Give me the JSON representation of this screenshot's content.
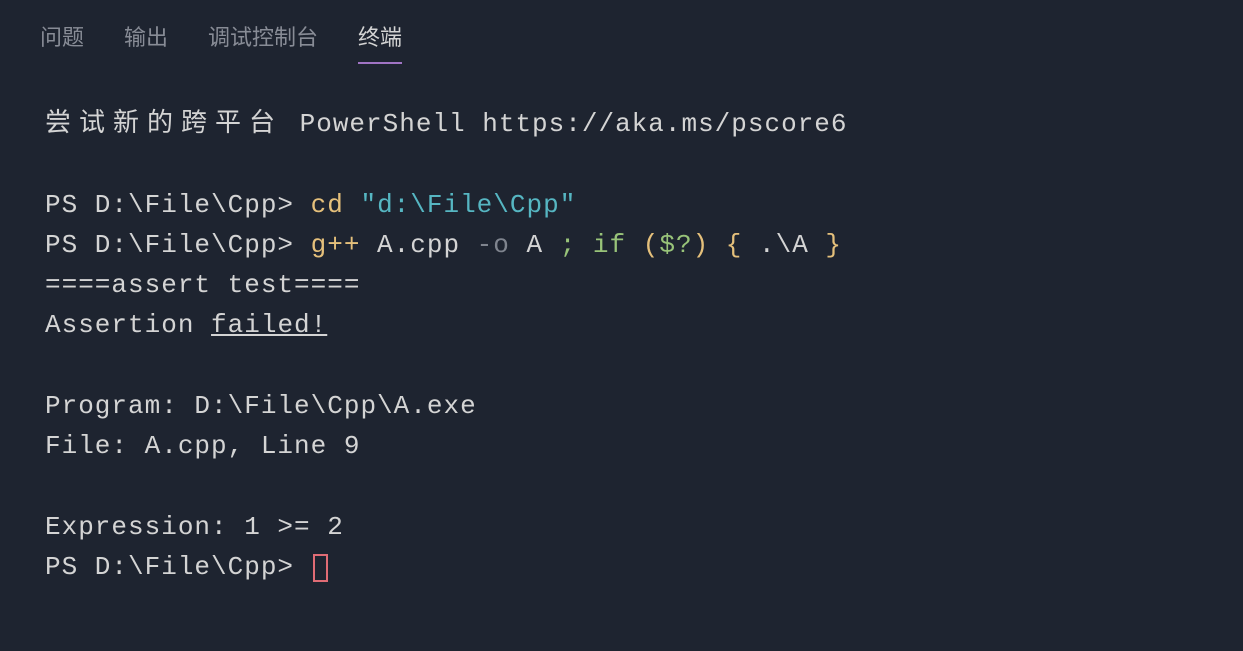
{
  "tabs": {
    "problems": "问题",
    "output": "输出",
    "debug_console": "调试控制台",
    "terminal": "终端"
  },
  "banner": {
    "cn": "尝试新的跨平台",
    "en": " PowerShell https://aka.ms/pscore6"
  },
  "prompt": "PS D:\\File\\Cpp> ",
  "cmd1": {
    "cd": "cd",
    "path": " \"d:\\File\\Cpp\""
  },
  "cmd2": {
    "gpp": "g++",
    "args1": " A.cpp ",
    "flag": "-o",
    "args2": " A ",
    "semi": ";",
    "sp1": " ",
    "if": "if",
    "sp2": " ",
    "lparen": "(",
    "var": "$?",
    "rparen": ")",
    "sp3": " ",
    "lbrace": "{",
    "run": " .\\A ",
    "rbrace": "}"
  },
  "out": {
    "l1": "====assert test====",
    "l2a": "Assertion ",
    "l2b": "failed!",
    "l3": "Program: D:\\File\\Cpp\\A.exe",
    "l4": "File: A.cpp, Line 9",
    "l5": "Expression: 1 >= 2"
  }
}
